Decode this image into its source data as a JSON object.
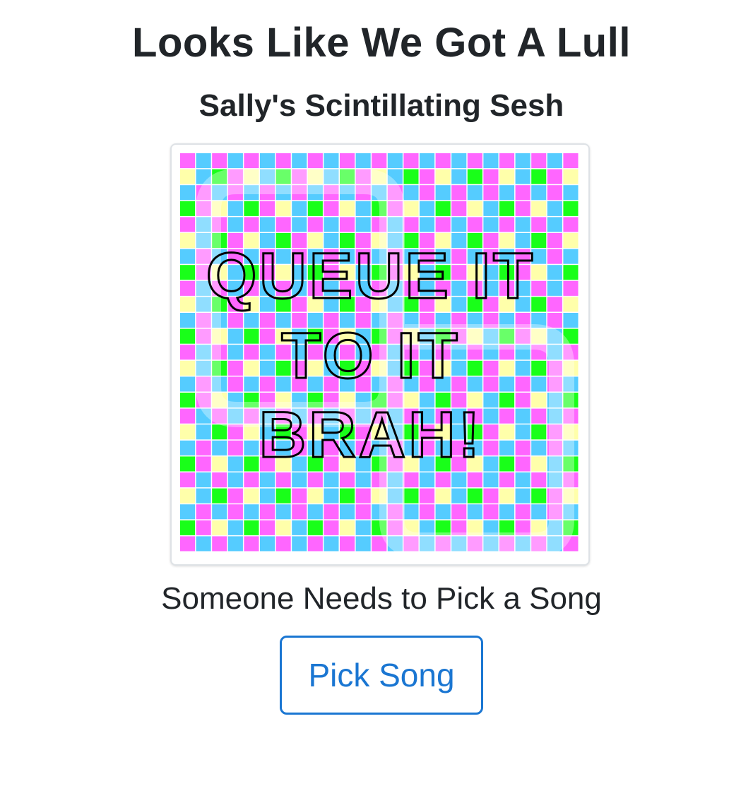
{
  "page": {
    "title": "Looks Like We Got A Lull",
    "session_name": "Sally's Scintillating Sesh",
    "status_message": "Someone Needs to Pick a Song"
  },
  "album_art": {
    "lines": [
      "QUEUE IT",
      "TO IT",
      "BRAH!"
    ],
    "palette": [
      "#ff66ff",
      "#19ff19",
      "#55ccff",
      "#ffffaa"
    ]
  },
  "actions": {
    "pick_song_label": "Pick Song"
  },
  "colors": {
    "accent": "#1a76d2",
    "text": "#212529"
  }
}
